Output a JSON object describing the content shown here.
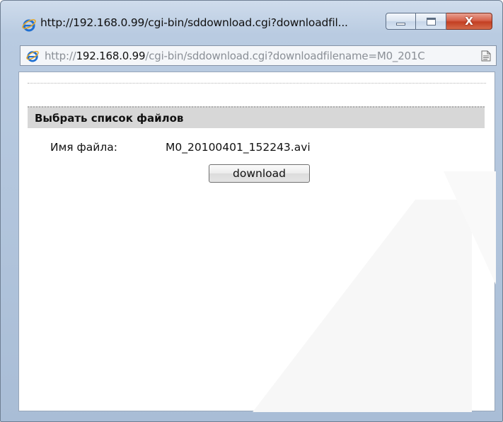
{
  "window": {
    "title": "http://192.168.0.99/cgi-bin/sddownload.cgi?downloadfil...",
    "close_glyph": "X"
  },
  "address_bar": {
    "scheme": "http://",
    "host": "192.168.0.99",
    "path": "/cgi-bin/sddownload.cgi?downloadfilename=M0_201C"
  },
  "page": {
    "section_title": "Выбрать список файлов",
    "file_label": "Имя файла:",
    "file_name": "M0_20100401_152243.avi",
    "download_label": "download"
  },
  "colors": {
    "section_header_bg": "#d7d7d7",
    "close_button": "#c33f22",
    "ie_blue": "#1f6fd1"
  }
}
